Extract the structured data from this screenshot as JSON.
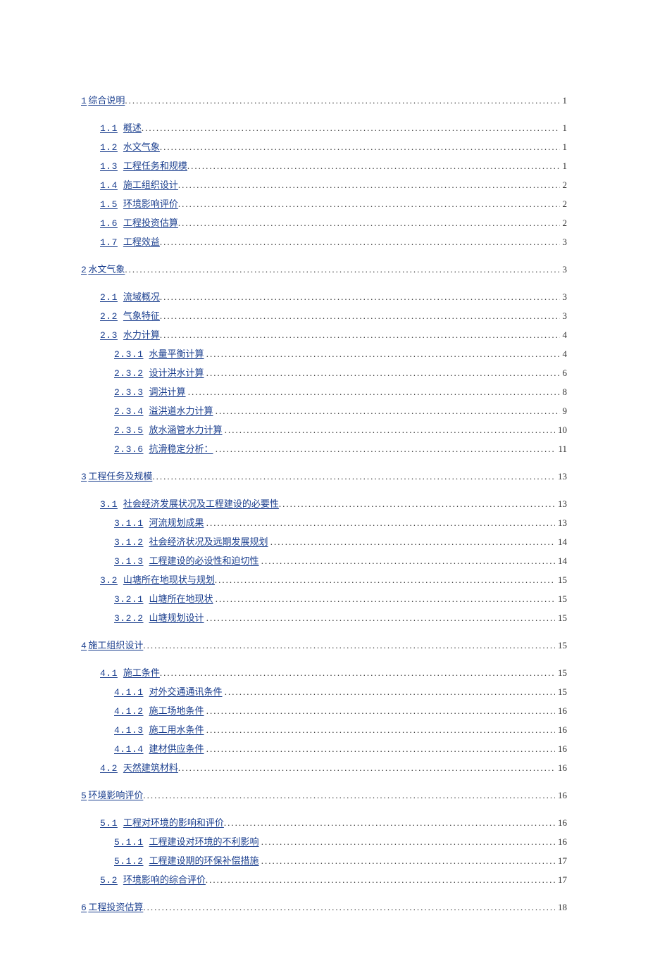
{
  "toc": [
    {
      "level": 1,
      "num": "1",
      "title": "综合说明",
      "page": "1"
    },
    {
      "level": 2,
      "num": "1.1",
      "title": "概述",
      "page": "1"
    },
    {
      "level": 2,
      "num": "1.2",
      "title": "水文气象",
      "page": "1"
    },
    {
      "level": 2,
      "num": "1.3",
      "title": "工程任务和规模",
      "page": "1"
    },
    {
      "level": 2,
      "num": "1.4",
      "title": "施工组织设计",
      "page": "2"
    },
    {
      "level": 2,
      "num": "1.5",
      "title": "环境影响评价",
      "page": "2"
    },
    {
      "level": 2,
      "num": "1.6",
      "title": "工程投资估算",
      "page": "2"
    },
    {
      "level": 2,
      "num": "1.7",
      "title": "工程效益",
      "page": "3"
    },
    {
      "level": 1,
      "num": "2",
      "title": "水文气象",
      "page": "3"
    },
    {
      "level": 2,
      "num": "2.1",
      "title": "流域概况",
      "page": "3"
    },
    {
      "level": 2,
      "num": "2.2",
      "title": "气象特征",
      "page": "3"
    },
    {
      "level": 2,
      "num": "2.3",
      "title": "水力计算",
      "page": "4"
    },
    {
      "level": 3,
      "num": "2.3.1",
      "title": "水量平衡计算",
      "page": "4"
    },
    {
      "level": 3,
      "num": "2.3.2",
      "title": "设计洪水计算",
      "page": "6"
    },
    {
      "level": 3,
      "num": "2.3.3",
      "title": "调洪计算",
      "page": "8"
    },
    {
      "level": 3,
      "num": "2.3.4",
      "title": "溢洪道水力计算",
      "page": "9"
    },
    {
      "level": 3,
      "num": "2.3.5",
      "title": "放水涵管水力计算",
      "page": "10"
    },
    {
      "level": 3,
      "num": "2.3.6",
      "title": "抗滑稳定分析：",
      "page": "11"
    },
    {
      "level": 1,
      "num": "3",
      "title": "工程任务及规模",
      "page": "13"
    },
    {
      "level": 2,
      "num": "3.1",
      "title": "社会经济发展状况及工程建设的必要性",
      "page": "13"
    },
    {
      "level": 3,
      "num": "3.1.1",
      "title": "河流规划成果",
      "page": "13"
    },
    {
      "level": 3,
      "num": "3.1.2",
      "title": "社会经济状况及远期发展规划",
      "page": "14"
    },
    {
      "level": 3,
      "num": "3.1.3",
      "title": "工程建设的必设性和迫切性",
      "page": "14"
    },
    {
      "level": 2,
      "num": "3.2",
      "title": "山塘所在地现状与规划",
      "page": "15"
    },
    {
      "level": 3,
      "num": "3.2.1",
      "title": "山塘所在地现状",
      "page": "15"
    },
    {
      "level": 3,
      "num": "3.2.2",
      "title": "山塘规划设计",
      "page": "15"
    },
    {
      "level": 1,
      "num": "4",
      "title": "施工组织设计",
      "page": "15"
    },
    {
      "level": 2,
      "num": "4.1",
      "title": "施工条件",
      "page": "15"
    },
    {
      "level": 3,
      "num": "4.1.1",
      "title": "对外交通通讯条件",
      "page": "15"
    },
    {
      "level": 3,
      "num": "4.1.2",
      "title": "施工场地条件",
      "page": "16"
    },
    {
      "level": 3,
      "num": "4.1.3",
      "title": "施工用水条件",
      "page": "16"
    },
    {
      "level": 3,
      "num": "4.1.4",
      "title": "建材供应条件",
      "page": "16"
    },
    {
      "level": 2,
      "num": "4.2",
      "title": "天然建筑材料",
      "page": "16"
    },
    {
      "level": 1,
      "num": "5",
      "title": "环境影响评价",
      "page": "16"
    },
    {
      "level": 2,
      "num": "5.1",
      "title": "工程对环境的影响和评价",
      "page": "16"
    },
    {
      "level": 3,
      "num": "5.1.1",
      "title": "工程建设对环境的不利影响",
      "page": "16"
    },
    {
      "level": 3,
      "num": "5.1.2",
      "title": "工程建设期的环保补偿措施",
      "page": "17"
    },
    {
      "level": 2,
      "num": "5.2",
      "title": "环境影响的综合评价",
      "page": "17"
    },
    {
      "level": 1,
      "num": "6",
      "title": "工程投资估算",
      "page": "18"
    }
  ]
}
